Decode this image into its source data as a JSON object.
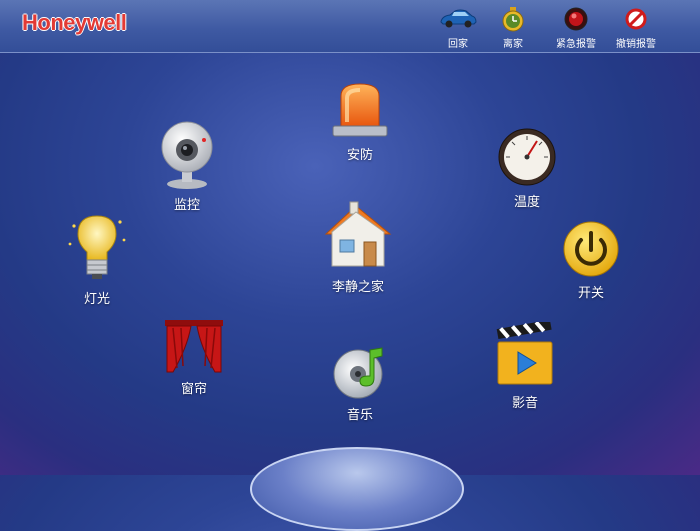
{
  "brand": {
    "logo_text": "Honeywell"
  },
  "quick_actions": [
    {
      "label": "回家",
      "icon": "car-icon"
    },
    {
      "label": "离家",
      "icon": "clock-icon"
    },
    {
      "label": "紧急报警",
      "icon": "alarm-button-icon"
    },
    {
      "label": "撤销报警",
      "icon": "cancel-alarm-icon"
    }
  ],
  "apps": {
    "security": "安防",
    "monitor": "监控",
    "temperature": "温度",
    "home": "李静之家",
    "lighting": "灯光",
    "power": "开关",
    "curtain": "窗帘",
    "music": "音乐",
    "video": "影音"
  },
  "colors": {
    "brand_red": "#e23a35",
    "background": "#2d4596",
    "power_yellow": "#f3c21a"
  }
}
